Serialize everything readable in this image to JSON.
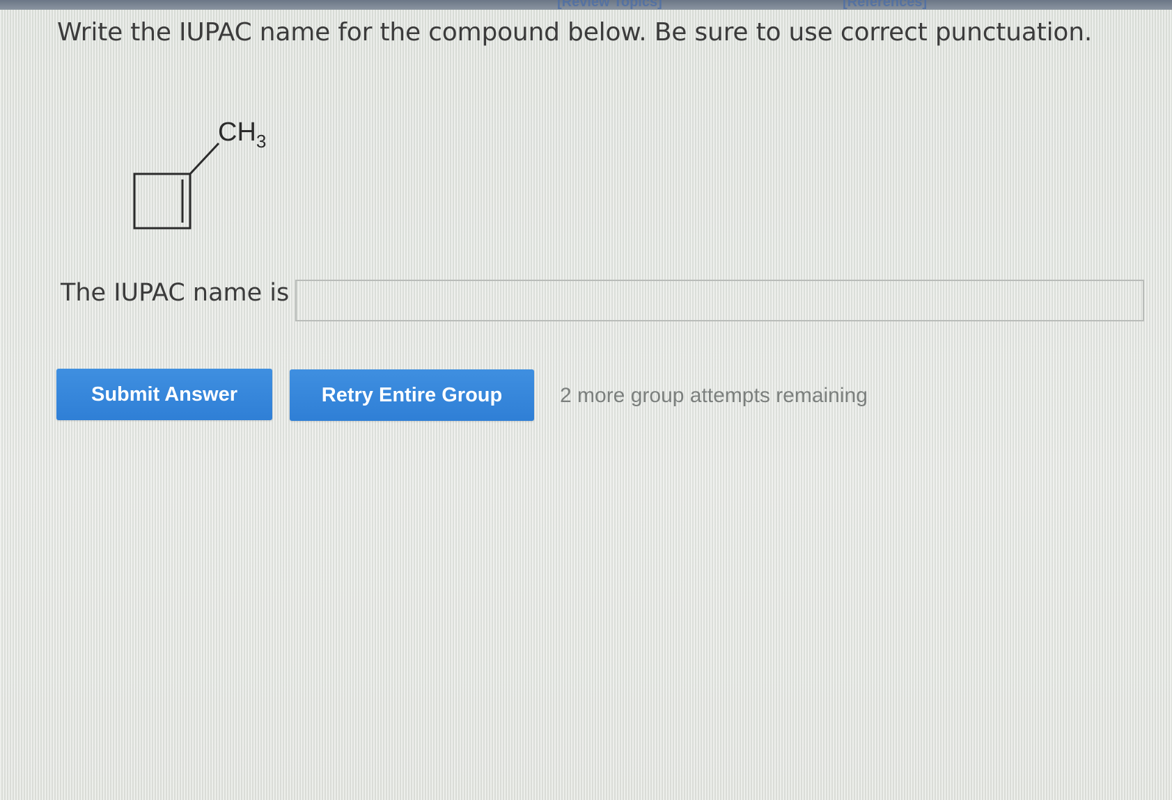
{
  "header": {
    "review_topics_link": "[Review Topics]",
    "references_link": "[References]"
  },
  "question": {
    "prompt": "Write the IUPAC name for the compound below. Be sure to use correct punctuation."
  },
  "molecule": {
    "substituent_label": "CH",
    "substituent_subscript": "3"
  },
  "answer": {
    "label": "The IUPAC name is",
    "value": "",
    "placeholder": ""
  },
  "actions": {
    "submit_label": "Submit Answer",
    "retry_label": "Retry Entire Group",
    "attempts_text": "2 more group attempts remaining"
  },
  "colors": {
    "button_blue": "#3a8ade",
    "text_dark": "#3b3b3b",
    "text_muted": "#7b7f7d"
  }
}
